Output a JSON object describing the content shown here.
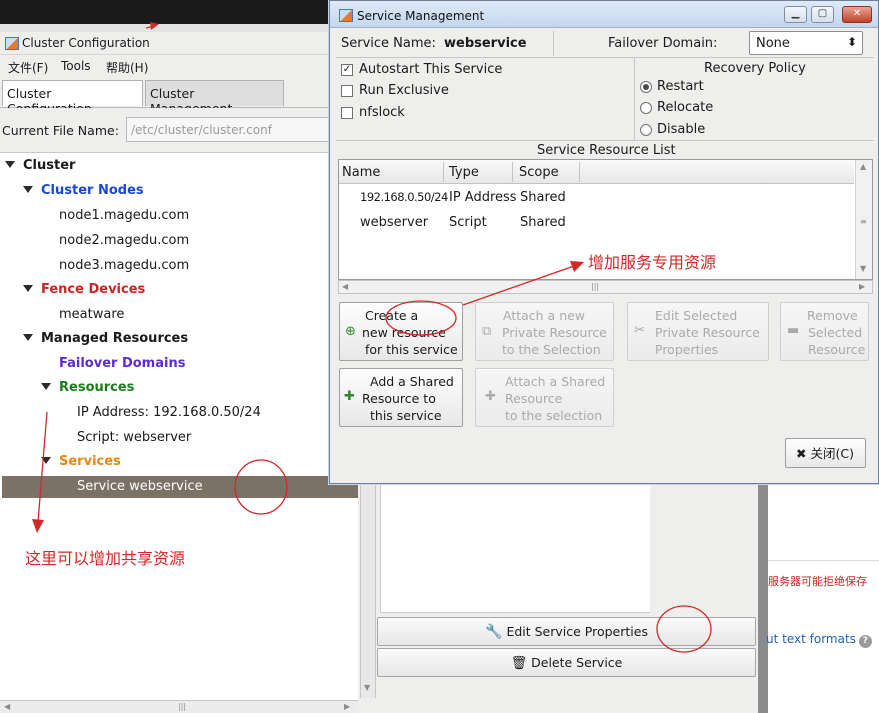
{
  "background_window": {
    "title": "Cluster Configuration",
    "menu": [
      "文件(F)",
      "Tools",
      "帮助(H)"
    ],
    "tabs": [
      "Cluster Configuration",
      "Cluster Management"
    ],
    "current_file_label": "Current File Name:",
    "current_file_value": "/etc/cluster/cluster.conf",
    "tree": {
      "cluster": "Cluster",
      "cluster_nodes": "Cluster Nodes",
      "nodes": [
        "node1.magedu.com",
        "node2.magedu.com",
        "node3.magedu.com"
      ],
      "fence_devices": "Fence Devices",
      "fence_items": [
        "meatware"
      ],
      "managed_resources": "Managed Resources",
      "failover_domains": "Failover Domains",
      "resources": "Resources",
      "resource_items": [
        "IP Address:  192.168.0.50/24",
        "Script:  webserver"
      ],
      "services": "Services",
      "service_items": [
        "Service webservice"
      ]
    },
    "edit_service_properties": "Edit Service Properties",
    "delete_service": "Delete Service"
  },
  "browser_fragment": {
    "warning_text": "服务器可能拒绝保存",
    "text_formats_link": "ut text formats"
  },
  "dialog": {
    "title": "Service Management",
    "service_name_label": "Service Name:",
    "service_name_value": "webservice",
    "failover_domain_label": "Failover Domain:",
    "failover_domain_value": "None",
    "checkboxes": [
      {
        "label": "Autostart This Service",
        "checked": true
      },
      {
        "label": "Run Exclusive",
        "checked": false
      },
      {
        "label": "nfslock",
        "checked": false
      }
    ],
    "recovery_policy_title": "Recovery Policy",
    "recovery_options": [
      {
        "label": "Restart",
        "selected": true
      },
      {
        "label": "Relocate",
        "selected": false
      },
      {
        "label": "Disable",
        "selected": false
      }
    ],
    "resource_list_title": "Service Resource List",
    "columns": [
      "Name",
      "Type",
      "Scope"
    ],
    "rows": [
      [
        "192.168.0.50/24",
        "IP Address",
        "Shared"
      ],
      [
        "webserver",
        "Script",
        "Shared"
      ]
    ],
    "buttons": {
      "create_new_resource": [
        "Create a",
        "new resource",
        "for this service"
      ],
      "attach_private": [
        "Attach a new",
        "Private Resource",
        "to the Selection"
      ],
      "edit_selected": [
        "Edit Selected",
        "Private Resource",
        "Properties"
      ],
      "remove_selected": [
        "Remove",
        "Selected",
        "Resource"
      ],
      "add_shared": [
        "Add a Shared",
        "Resource to",
        "this service"
      ],
      "attach_shared": [
        "Attach a Shared",
        "Resource",
        "to the selection"
      ],
      "close": "关闭(C)"
    }
  },
  "annotations": {
    "add_private_resource": "增加服务专用资源",
    "add_shared_resource": "这里可以增加共享资源"
  },
  "colors": {
    "annotation_red": "#d42727",
    "tree_selection": "#7b7167",
    "node_blue": "#1b47d6"
  }
}
